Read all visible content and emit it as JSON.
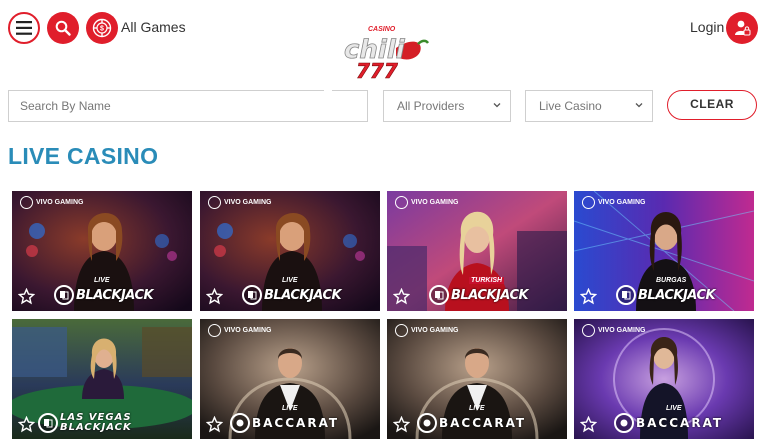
{
  "header": {
    "all_games_label": "All Games",
    "login_label": "Login",
    "logo": {
      "top_text": "CASINO",
      "main_text": "chili",
      "digits": "777"
    }
  },
  "filters": {
    "search_placeholder": "Search By Name",
    "provider_selected": "All Providers",
    "category_selected": "Live Casino",
    "clear_label": "CLEAR"
  },
  "section_title": "LIVE CASINO",
  "colors": {
    "accent": "#e01e2b",
    "title": "#2a8cb8"
  },
  "games": [
    {
      "name": "BLACKJACK",
      "prefix": "LIVE",
      "provider_badge": "VIVO GAMING"
    },
    {
      "name": "BLACKJACK",
      "prefix": "LIVE",
      "provider_badge": "VIVO GAMING"
    },
    {
      "name": "BLACKJACK",
      "prefix": "TURKISH",
      "provider_badge": "VIVO GAMING"
    },
    {
      "name": "BLACKJACK",
      "prefix": "BURGAS",
      "provider_badge": "VIVO GAMING"
    },
    {
      "name": "LAS VEGAS BLACKJACK",
      "prefix": "",
      "provider_badge": ""
    },
    {
      "name": "BACCARAT",
      "prefix": "LIVE",
      "provider_badge": "VIVO GAMING"
    },
    {
      "name": "BACCARAT",
      "prefix": "LIVE",
      "provider_badge": "VIVO GAMING"
    },
    {
      "name": "BACCARAT",
      "prefix": "LIVE",
      "provider_badge": "VIVO GAMING"
    }
  ]
}
